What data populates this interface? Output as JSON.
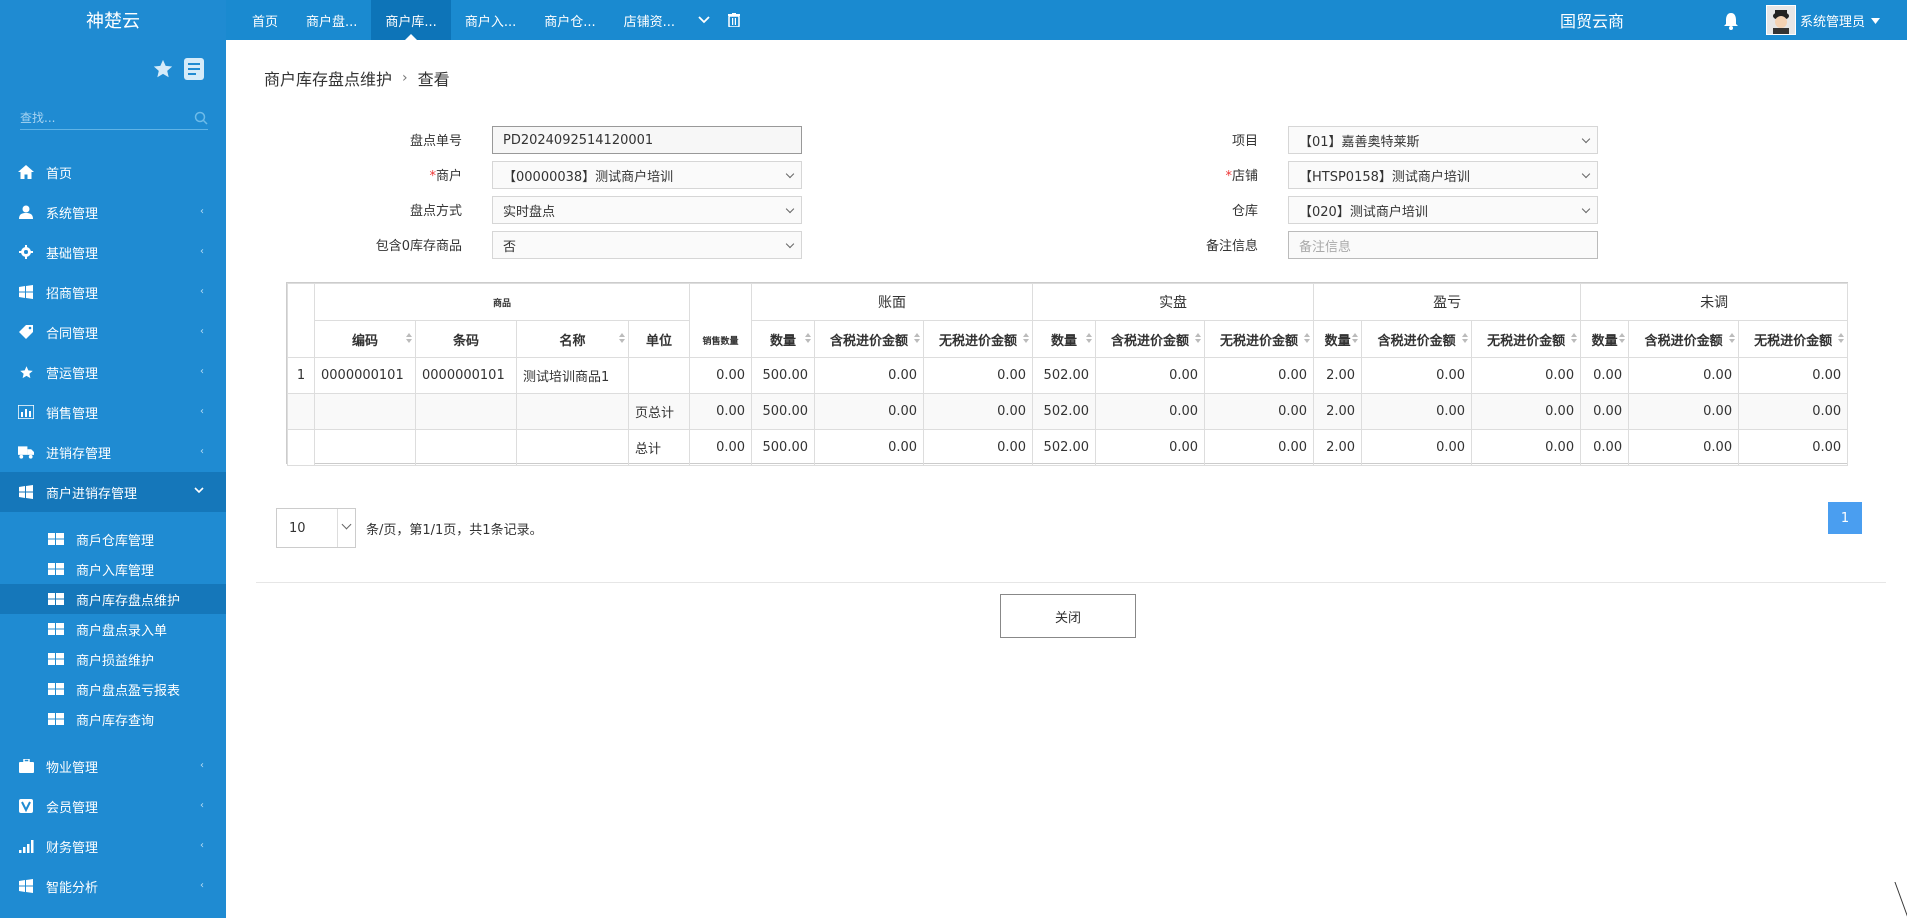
{
  "app": {
    "brand": "神楚云",
    "org_title": "国贸云商",
    "user_name": "系统管理员"
  },
  "top_tabs": [
    {
      "label": "首页"
    },
    {
      "label": "商户盘..."
    },
    {
      "label": "商户库..."
    },
    {
      "label": "商户入..."
    },
    {
      "label": "商户仓..."
    },
    {
      "label": "店铺资..."
    }
  ],
  "sidebar": {
    "search_placeholder": "查找...",
    "menu": [
      {
        "label": "首页",
        "icon": "home-icon"
      },
      {
        "label": "系统管理",
        "icon": "user-icon"
      },
      {
        "label": "基础管理",
        "icon": "gear-icon"
      },
      {
        "label": "招商管理",
        "icon": "windows-icon"
      },
      {
        "label": "合同管理",
        "icon": "tag-icon"
      },
      {
        "label": "营运管理",
        "icon": "star-icon"
      },
      {
        "label": "销售管理",
        "icon": "chart-icon"
      },
      {
        "label": "进销存管理",
        "icon": "truck-icon"
      },
      {
        "label": "商户进销存管理",
        "icon": "windows-icon"
      }
    ],
    "sub_menu": [
      {
        "label": "商戶仓库管理"
      },
      {
        "label": "商户入库管理"
      },
      {
        "label": "商户库存盘点维护"
      },
      {
        "label": "商户盘点录入单"
      },
      {
        "label": "商户损益维护"
      },
      {
        "label": "商户盘点盈亏报表"
      },
      {
        "label": "商户库存查询"
      }
    ],
    "menu_after": [
      {
        "label": "物业管理",
        "icon": "briefcase-icon"
      },
      {
        "label": "会员管理",
        "icon": "vip-icon"
      },
      {
        "label": "财务管理",
        "icon": "signal-icon"
      },
      {
        "label": "智能分析",
        "icon": "windows-icon"
      }
    ]
  },
  "breadcrumb": {
    "parent": "商户库存盘点维护",
    "current": "查看"
  },
  "form": {
    "order_no_label": "盘点单号",
    "order_no": "PD2024092514120001",
    "merchant_label": "商户",
    "merchant": "【00000038】测试商户培训",
    "method_label": "盘点方式",
    "method": "实时盘点",
    "include_zero_label": "包含0库存商品",
    "include_zero": "否",
    "project_label": "项目",
    "project": "【01】嘉善奥特莱斯",
    "shop_label": "店铺",
    "shop": "【HTSP0158】测试商户培训",
    "warehouse_label": "仓库",
    "warehouse": "【020】测试商户培训",
    "remark_label": "备注信息",
    "remark_placeholder": "备注信息",
    "required_mark": "*"
  },
  "table": {
    "group_headers": {
      "goods": "商品",
      "sales_qty": "销售数量",
      "book": "账面",
      "actual": "实盘",
      "profit_loss": "盈亏",
      "unadjusted": "未调"
    },
    "goods_columns": [
      "编码",
      "条码",
      "名称",
      "单位"
    ],
    "value_columns": [
      "数量",
      "含税进价金额",
      "无税进价金额"
    ],
    "rows": [
      {
        "rn": "1",
        "code": "0000000101",
        "barcode": "0000000101",
        "name": "测试培训商品1",
        "unit": "",
        "sales": "0.00",
        "book": [
          "500.00",
          "0.00",
          "0.00"
        ],
        "actual": [
          "502.00",
          "0.00",
          "0.00"
        ],
        "pl": [
          "2.00",
          "0.00",
          "0.00"
        ],
        "un": [
          "0.00",
          "0.00",
          "0.00"
        ]
      },
      {
        "rn": "",
        "code": "",
        "barcode": "",
        "name": "",
        "unit": "页总计",
        "sales": "0.00",
        "book": [
          "500.00",
          "0.00",
          "0.00"
        ],
        "actual": [
          "502.00",
          "0.00",
          "0.00"
        ],
        "pl": [
          "2.00",
          "0.00",
          "0.00"
        ],
        "un": [
          "0.00",
          "0.00",
          "0.00"
        ]
      },
      {
        "rn": "",
        "code": "",
        "barcode": "",
        "name": "",
        "unit": "总计",
        "sales": "0.00",
        "book": [
          "500.00",
          "0.00",
          "0.00"
        ],
        "actual": [
          "502.00",
          "0.00",
          "0.00"
        ],
        "pl": [
          "2.00",
          "0.00",
          "0.00"
        ],
        "un": [
          "0.00",
          "0.00",
          "0.00"
        ]
      }
    ]
  },
  "pager": {
    "page_size": "10",
    "summary": "条/页，第1/1页，共1条记录。",
    "current_page": "1"
  },
  "actions": {
    "close_label": "关闭"
  },
  "colors": {
    "primary": "#1a8ad0",
    "sidebar_active": "#1577ba",
    "pager_active": "#4a9ef0"
  }
}
